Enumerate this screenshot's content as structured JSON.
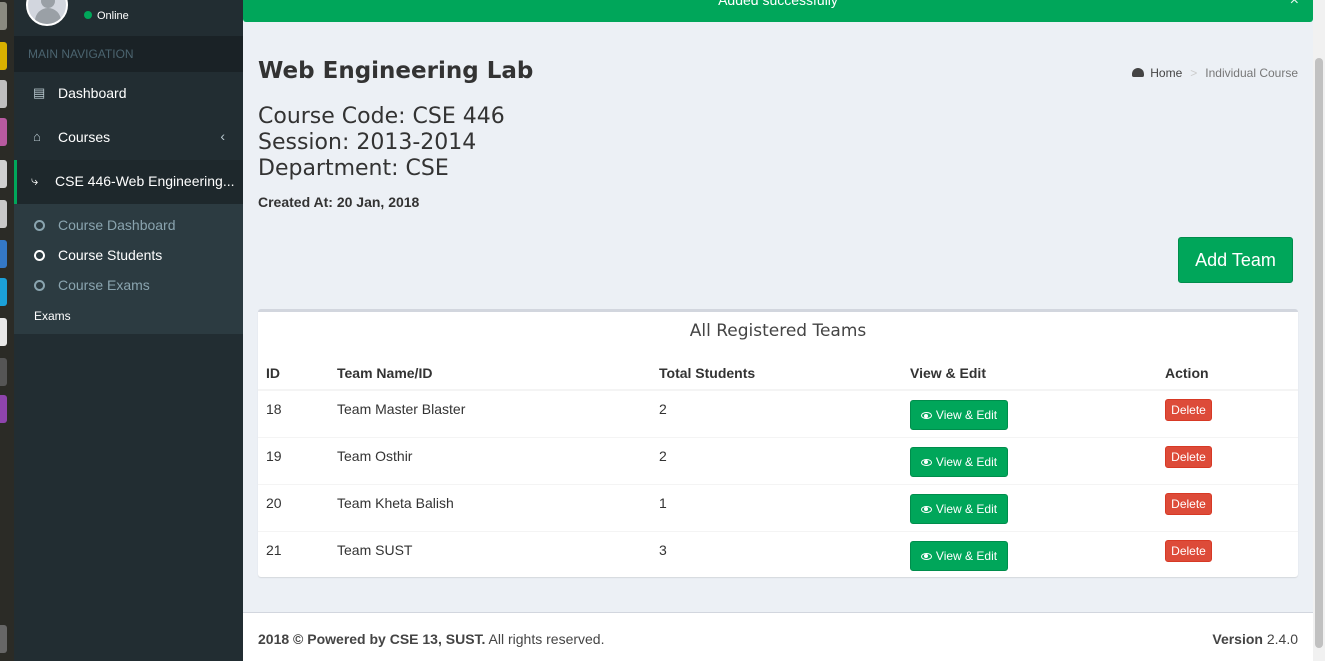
{
  "sidebar": {
    "status": "Online",
    "nav_header": "MAIN NAVIGATION",
    "items": [
      {
        "label": "Dashboard"
      },
      {
        "label": "Courses"
      },
      {
        "label": "CSE 446-Web Engineering..."
      }
    ],
    "subitems": [
      {
        "label": "Course Dashboard"
      },
      {
        "label": "Course Students"
      },
      {
        "label": "Course Exams"
      }
    ],
    "exams_label": "Exams"
  },
  "alert": {
    "message": "Added successfully",
    "close": "×"
  },
  "page": {
    "title": "Web Engineering Lab",
    "breadcrumb": {
      "home": "Home",
      "current": "Individual Course"
    },
    "course_code": "Course Code: CSE 446",
    "session": "Session: 2013-2014",
    "department": "Department: CSE",
    "created": "Created At: 20 Jan, 2018",
    "add_team": "Add Team"
  },
  "teams": {
    "title": "All Registered Teams",
    "columns": [
      "ID",
      "Team Name/ID",
      "Total Students",
      "View & Edit",
      "Action"
    ],
    "view_label": "View & Edit",
    "delete_label": "Delete",
    "rows": [
      {
        "id": "18",
        "name": "Team Master Blaster",
        "total": "2"
      },
      {
        "id": "19",
        "name": "Team Osthir",
        "total": "2"
      },
      {
        "id": "20",
        "name": "Team Kheta Balish",
        "total": "1"
      },
      {
        "id": "21",
        "name": "Team SUST",
        "total": "3"
      }
    ]
  },
  "footer": {
    "year": "2018 ©",
    "powered": "Powered by CSE 13, SUST.",
    "rights": "All rights reserved.",
    "version_label": "Version",
    "version": "2.4.0"
  },
  "colors": {
    "primary": "#00a65a",
    "danger": "#dd4b39",
    "sidebar": "#222d32"
  }
}
